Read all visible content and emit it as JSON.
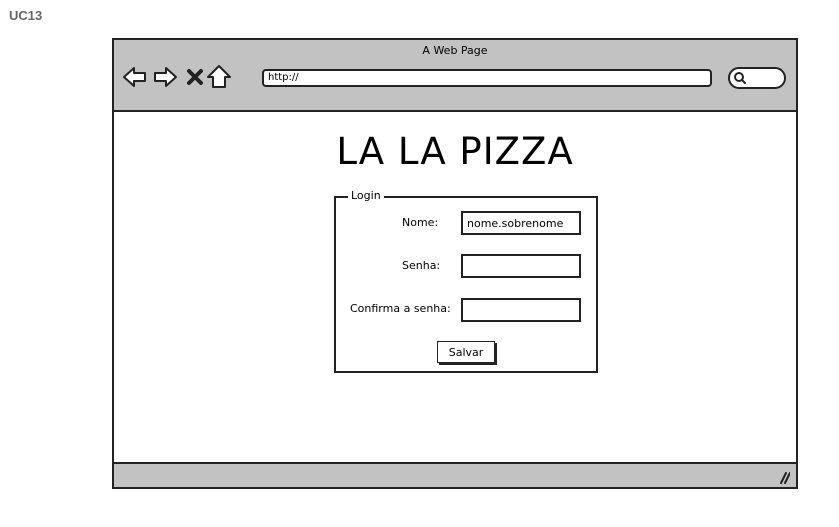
{
  "page_label": "UC13",
  "browser": {
    "title": "A Web Page",
    "address": "http://",
    "icons": [
      "back-arrow-icon",
      "forward-arrow-icon",
      "close-x-icon",
      "home-icon",
      "search-icon",
      "resize-grip-icon"
    ]
  },
  "main": {
    "brand": "LA LA PIZZA",
    "form": {
      "legend": "Login",
      "fields": [
        {
          "label": "Nome:",
          "value": "nome.sobrenome"
        },
        {
          "label": "Senha:",
          "value": ""
        },
        {
          "label": "Confirma a senha:",
          "value": ""
        }
      ],
      "submit_label": "Salvar"
    }
  }
}
